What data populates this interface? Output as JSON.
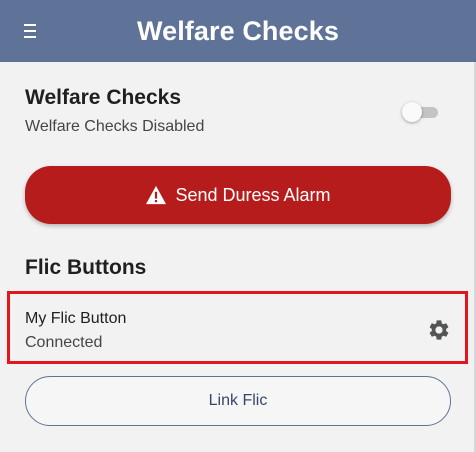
{
  "appbar": {
    "title": "Welfare Checks",
    "menu_icon": "hamburger-menu-icon",
    "background_color": "#5f7399"
  },
  "welfare_checks": {
    "title": "Welfare Checks",
    "status": "Welfare Checks Disabled",
    "toggle_on": false
  },
  "duress": {
    "label": "Send Duress Alarm",
    "icon": "warning-triangle-icon",
    "color": "#b71c1c"
  },
  "flic": {
    "heading": "Flic Buttons",
    "items": [
      {
        "name": "My Flic Button",
        "status": "Connected",
        "icon": "gear-icon",
        "highlight_color": "#e3161c"
      }
    ],
    "link_label": "Link Flic"
  }
}
